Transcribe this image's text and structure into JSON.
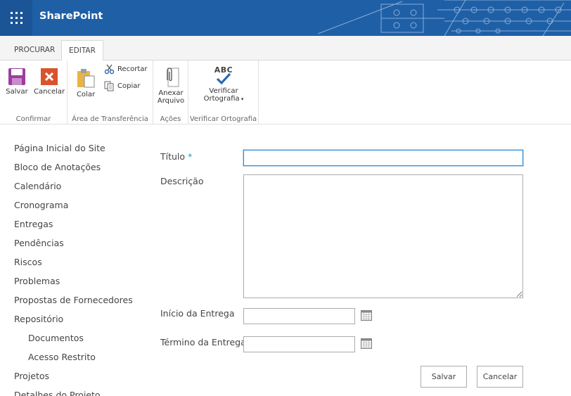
{
  "suitebar": {
    "brand": "SharePoint"
  },
  "tabs": [
    {
      "label": "PROCURAR"
    },
    {
      "label": "EDITAR"
    }
  ],
  "ribbon": {
    "groups": {
      "confirmar": {
        "label": "Confirmar",
        "save": "Salvar",
        "cancel": "Cancelar"
      },
      "clipboard": {
        "label": "Área de Transferência",
        "paste": "Colar",
        "cut": "Recortar",
        "copy": "Copiar"
      },
      "actions": {
        "label": "Ações",
        "attach_line1": "Anexar",
        "attach_line2": "Arquivo"
      },
      "spelling": {
        "label": "Verificar Ortografia",
        "icon_text": "ABC",
        "btn_line1": "Verificar",
        "btn_line2": "Ortografia"
      }
    }
  },
  "nav": {
    "items": [
      "Página Inicial do Site",
      "Bloco de Anotações",
      "Calendário",
      "Cronograma",
      "Entregas",
      "Pendências",
      "Riscos",
      "Problemas",
      "Propostas de Fornecedores",
      "Repositório",
      "Documentos",
      "Acesso Restrito",
      "Projetos",
      "Detalhes do Projeto"
    ]
  },
  "form": {
    "title_label": "Título",
    "required_mark": "*",
    "title_value": "",
    "description_label": "Descrição",
    "description_value": "",
    "start_label": "Início da Entrega",
    "start_value": "",
    "end_label": "Término da Entrega",
    "end_value": "",
    "save_label": "Salvar",
    "cancel_label": "Cancelar"
  },
  "colors": {
    "suitebar": "#1f5fa6",
    "accent": "#2a8dd4",
    "cancel_icon": "#d9532c",
    "save_icon": "#9b3f9e"
  }
}
